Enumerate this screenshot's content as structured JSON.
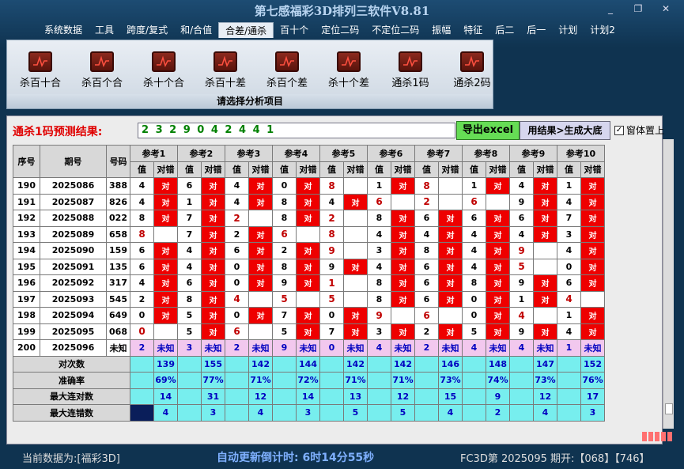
{
  "window": {
    "title": "第七感福彩3D排列三软件V8.81",
    "min": "_",
    "restore": "❐",
    "close": "✕"
  },
  "menu": [
    "系统数据",
    "工具",
    "跨度/复式",
    "和/合值",
    "合差/通杀",
    "百十个",
    "定位二码",
    "不定位二码",
    "振幅",
    "特征",
    "后二",
    "后一",
    "计划",
    "计划2"
  ],
  "ribbon": {
    "buttons": [
      "杀百十合",
      "杀百个合",
      "杀十个合",
      "杀百十差",
      "杀百个差",
      "杀十个差",
      "通杀1码",
      "通杀2码"
    ],
    "caption": "请选择分析项目"
  },
  "prediction": {
    "label": "通杀1码预测结果:",
    "value": "2 3 2 9 0 4 2 4 4 1",
    "export_btn": "导出excel",
    "gen_btn": "用结果>生成大底",
    "topmost_label": "窗体置上",
    "topmost_checked": "✓"
  },
  "table": {
    "head_top": [
      "序号",
      "期号",
      "号码"
    ],
    "refs": [
      "参考1",
      "参考2",
      "参考3",
      "参考4",
      "参考5",
      "参考6",
      "参考7",
      "参考8",
      "参考9",
      "参考10"
    ],
    "sub": [
      "值",
      "对错"
    ],
    "mark": "对",
    "rows": [
      {
        "seq": "190",
        "period": "2025086",
        "num": "388",
        "cells": [
          [
            "4",
            1
          ],
          [
            "6",
            1
          ],
          [
            "4",
            1
          ],
          [
            "0",
            1
          ],
          [
            "8",
            0,
            1
          ],
          [
            "1",
            1
          ],
          [
            "8",
            0,
            1
          ],
          [
            "1",
            1
          ],
          [
            "4",
            1
          ],
          [
            "1",
            1
          ]
        ]
      },
      {
        "seq": "191",
        "period": "2025087",
        "num": "826",
        "cells": [
          [
            "4",
            1
          ],
          [
            "1",
            1
          ],
          [
            "4",
            1
          ],
          [
            "8",
            1
          ],
          [
            "4",
            1
          ],
          [
            "6",
            0,
            1
          ],
          [
            "2",
            0,
            1
          ],
          [
            "6",
            0,
            1
          ],
          [
            "9",
            1
          ],
          [
            "4",
            1
          ]
        ]
      },
      {
        "seq": "192",
        "period": "2025088",
        "num": "022",
        "cells": [
          [
            "8",
            1
          ],
          [
            "7",
            1
          ],
          [
            "2",
            0,
            1
          ],
          [
            "8",
            1
          ],
          [
            "2",
            0,
            1
          ],
          [
            "8",
            1
          ],
          [
            "6",
            1
          ],
          [
            "6",
            1
          ],
          [
            "6",
            1
          ],
          [
            "7",
            1
          ]
        ]
      },
      {
        "seq": "193",
        "period": "2025089",
        "num": "658",
        "cells": [
          [
            "8",
            0,
            1
          ],
          [
            "7",
            1
          ],
          [
            "2",
            1
          ],
          [
            "6",
            0,
            1
          ],
          [
            "8",
            0,
            1
          ],
          [
            "4",
            1
          ],
          [
            "4",
            1
          ],
          [
            "4",
            1
          ],
          [
            "4",
            1
          ],
          [
            "3",
            1
          ]
        ]
      },
      {
        "seq": "194",
        "period": "2025090",
        "num": "159",
        "cells": [
          [
            "6",
            1
          ],
          [
            "4",
            1
          ],
          [
            "6",
            1
          ],
          [
            "2",
            1
          ],
          [
            "9",
            0,
            1
          ],
          [
            "3",
            1
          ],
          [
            "8",
            1
          ],
          [
            "4",
            1
          ],
          [
            "9",
            0,
            1
          ],
          [
            "4",
            1
          ]
        ]
      },
      {
        "seq": "195",
        "period": "2025091",
        "num": "135",
        "cells": [
          [
            "6",
            1
          ],
          [
            "4",
            1
          ],
          [
            "0",
            1
          ],
          [
            "8",
            1
          ],
          [
            "9",
            1
          ],
          [
            "4",
            1
          ],
          [
            "6",
            1
          ],
          [
            "4",
            1
          ],
          [
            "5",
            0,
            1
          ],
          [
            "0",
            1
          ]
        ]
      },
      {
        "seq": "196",
        "period": "2025092",
        "num": "317",
        "cells": [
          [
            "4",
            1
          ],
          [
            "6",
            1
          ],
          [
            "0",
            1
          ],
          [
            "9",
            1
          ],
          [
            "1",
            0,
            1
          ],
          [
            "8",
            1
          ],
          [
            "6",
            1
          ],
          [
            "8",
            1
          ],
          [
            "9",
            1
          ],
          [
            "6",
            1
          ]
        ]
      },
      {
        "seq": "197",
        "period": "2025093",
        "num": "545",
        "cells": [
          [
            "2",
            1
          ],
          [
            "8",
            1
          ],
          [
            "4",
            0,
            1
          ],
          [
            "5",
            0,
            1
          ],
          [
            "5",
            0,
            1
          ],
          [
            "8",
            1
          ],
          [
            "6",
            1
          ],
          [
            "0",
            1
          ],
          [
            "1",
            1
          ],
          [
            "4",
            0,
            1
          ]
        ]
      },
      {
        "seq": "198",
        "period": "2025094",
        "num": "649",
        "cells": [
          [
            "0",
            1
          ],
          [
            "5",
            1
          ],
          [
            "0",
            1
          ],
          [
            "7",
            1
          ],
          [
            "0",
            1
          ],
          [
            "9",
            0,
            1
          ],
          [
            "6",
            0,
            1
          ],
          [
            "0",
            1
          ],
          [
            "4",
            0,
            1
          ],
          [
            "1",
            1
          ]
        ]
      },
      {
        "seq": "199",
        "period": "2025095",
        "num": "068",
        "cells": [
          [
            "0",
            0,
            1
          ],
          [
            "5",
            1
          ],
          [
            "6",
            0,
            1
          ],
          [
            "5",
            1
          ],
          [
            "7",
            1
          ],
          [
            "3",
            1
          ],
          [
            "2",
            1
          ],
          [
            "5",
            1
          ],
          [
            "9",
            1
          ],
          [
            "4",
            1
          ]
        ]
      }
    ],
    "forecast": {
      "seq": "200",
      "period": "2025096",
      "num": "未知",
      "vals": [
        "2",
        "3",
        "2",
        "9",
        "0",
        "4",
        "2",
        "4",
        "4",
        "1"
      ],
      "status": "未知"
    },
    "stats": [
      {
        "label": "对次数",
        "vals": [
          "139",
          "155",
          "142",
          "144",
          "142",
          "142",
          "146",
          "148",
          "147",
          "152"
        ]
      },
      {
        "label": "准确率",
        "vals": [
          "69%",
          "77%",
          "71%",
          "72%",
          "71%",
          "71%",
          "73%",
          "74%",
          "73%",
          "76%"
        ]
      },
      {
        "label": "最大连对数",
        "vals": [
          "14",
          "31",
          "12",
          "14",
          "13",
          "12",
          "15",
          "9",
          "12",
          "17"
        ]
      },
      {
        "label": "最大连错数",
        "vals": [
          "4",
          "3",
          "4",
          "3",
          "5",
          "5",
          "4",
          "2",
          "4",
          "3"
        ]
      }
    ]
  },
  "status": {
    "current_data": "当前数据为:[福彩3D]",
    "countdown": "自动更新倒计时: 6时14分55秒",
    "latest": "FC3D第 2025095 期开:【068】【746】"
  }
}
